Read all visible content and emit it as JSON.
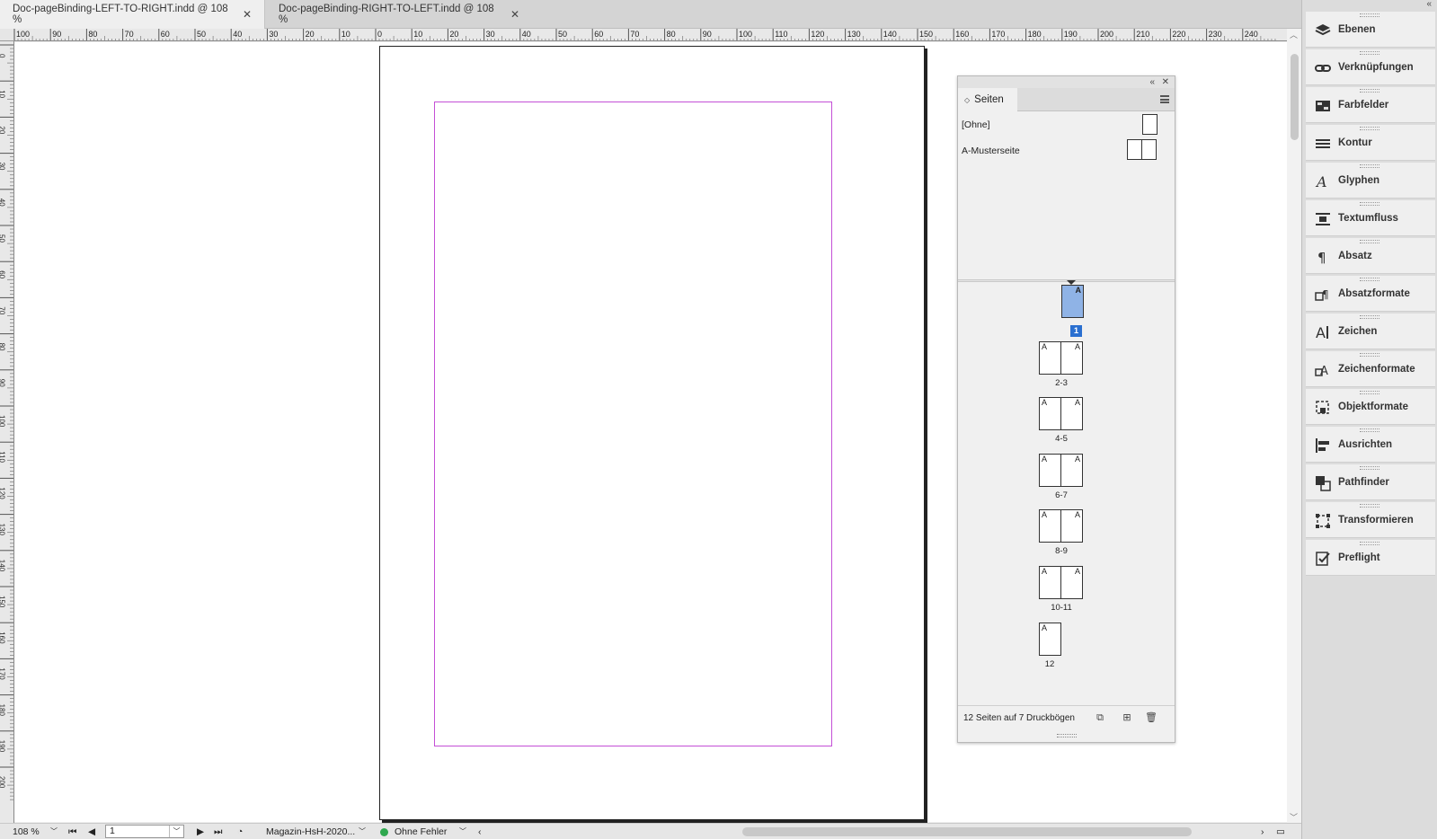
{
  "tabs": [
    {
      "label": "Doc-pageBinding-LEFT-TO-RIGHT.indd @ 108 %",
      "active": true
    },
    {
      "label": "Doc-pageBinding-RIGHT-TO-LEFT.indd @ 108 %",
      "active": false
    }
  ],
  "ruler": {
    "horizontal": [
      "100",
      "90",
      "80",
      "70",
      "60",
      "50",
      "40",
      "30",
      "20",
      "10",
      "0",
      "10",
      "20",
      "30",
      "40",
      "50",
      "60",
      "70",
      "80",
      "90",
      "100",
      "110",
      "120",
      "130",
      "140",
      "150",
      "160",
      "170",
      "180",
      "190",
      "200",
      "210",
      "220",
      "230",
      "240"
    ],
    "vertical": [
      "0",
      "10",
      "20",
      "30",
      "40",
      "50",
      "60",
      "70",
      "80",
      "90",
      "100",
      "110",
      "120",
      "130",
      "140",
      "150",
      "160",
      "170",
      "180",
      "190",
      "200"
    ]
  },
  "pages_panel": {
    "tab_label": "Seiten",
    "masters": [
      "[Ohne]",
      "A-Musterseite"
    ],
    "spreads": [
      {
        "label": "1",
        "pages": [
          "A"
        ]
      },
      {
        "label": "2-3",
        "pages": [
          "A",
          "A"
        ]
      },
      {
        "label": "4-5",
        "pages": [
          "A",
          "A"
        ]
      },
      {
        "label": "6-7",
        "pages": [
          "A",
          "A"
        ]
      },
      {
        "label": "8-9",
        "pages": [
          "A",
          "A"
        ]
      },
      {
        "label": "10-11",
        "pages": [
          "A",
          "A"
        ]
      },
      {
        "label": "12",
        "pages": [
          "A"
        ]
      }
    ],
    "selected_page": "1",
    "status": "12 Seiten auf 7 Druckbögen"
  },
  "dock": {
    "items": [
      {
        "label": "Ebenen",
        "icon": "layers-icon"
      },
      {
        "label": "Verknüpfungen",
        "icon": "links-icon"
      },
      {
        "label": "Farbfelder",
        "icon": "swatches-icon"
      },
      {
        "label": "Kontur",
        "icon": "stroke-icon"
      },
      {
        "label": "Glyphen",
        "icon": "glyphs-icon"
      },
      {
        "label": "Textumfluss",
        "icon": "text-wrap-icon"
      },
      {
        "label": "Absatz",
        "icon": "paragraph-icon"
      },
      {
        "label": "Absatzformate",
        "icon": "paragraph-styles-icon"
      },
      {
        "label": "Zeichen",
        "icon": "character-icon"
      },
      {
        "label": "Zeichenformate",
        "icon": "character-styles-icon"
      },
      {
        "label": "Objektformate",
        "icon": "object-styles-icon"
      },
      {
        "label": "Ausrichten",
        "icon": "align-icon"
      },
      {
        "label": "Pathfinder",
        "icon": "pathfinder-icon"
      },
      {
        "label": "Transformieren",
        "icon": "transform-icon"
      },
      {
        "label": "Preflight",
        "icon": "preflight-icon"
      }
    ]
  },
  "statusbar": {
    "zoom": "108 %",
    "page": "1",
    "profile": "Magazin-HsH-2020...",
    "preflight": "Ohne Fehler"
  },
  "colors": {
    "margin_guide": "#c44fd6",
    "selected_page": "#8fb3e6",
    "selected_badge": "#2a6fd0",
    "preflight_ok": "#2fa84f"
  }
}
